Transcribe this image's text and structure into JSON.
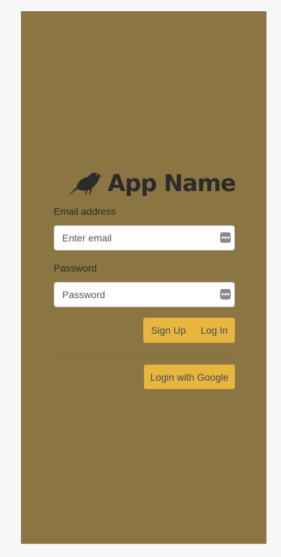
{
  "app": {
    "name": "App Name",
    "logo_icon": "crow-icon"
  },
  "form": {
    "email": {
      "label": "Email address",
      "placeholder": "Enter email",
      "value": ""
    },
    "password": {
      "label": "Password",
      "placeholder": "Password",
      "value": ""
    }
  },
  "actions": {
    "signup_label": "Sign Up",
    "login_label": "Log In",
    "google_label": "Login with Google"
  },
  "colors": {
    "background": "#8b7542",
    "button": "#e8b53e",
    "button_text": "#3f4b5a",
    "text": "#2b2b2b"
  }
}
